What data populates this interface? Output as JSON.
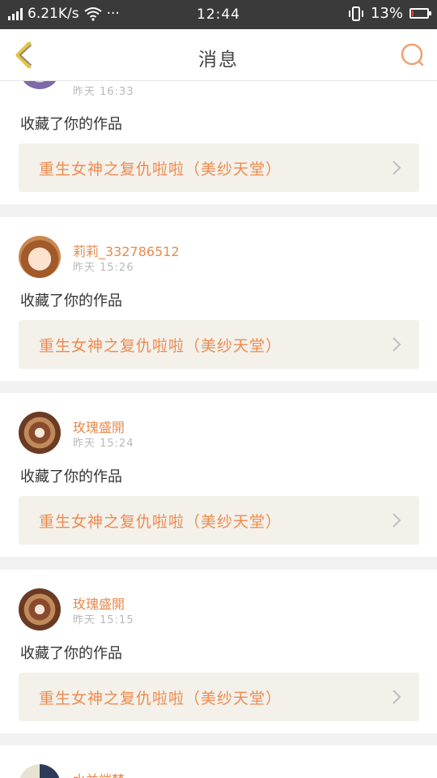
{
  "status_bar": {
    "speed": "6.21K/s",
    "more": "···",
    "time": "12:44",
    "battery": "13%",
    "battery_level": 0.13,
    "battery_color": "#e53935"
  },
  "header": {
    "title": "消息",
    "back_icon": "chevron-left-icon",
    "search_icon": "search-icon",
    "accent_color": "#f0a070"
  },
  "messages": [
    {
      "name": "",
      "time": "昨天 16:33",
      "action": "收藏了你的作品",
      "work": "重生女神之复仇啦啦（美纱天堂）"
    },
    {
      "name": "莉莉_332786512",
      "time": "昨天 15:26",
      "action": "收藏了你的作品",
      "work": "重生女神之复仇啦啦（美纱天堂）"
    },
    {
      "name": "玫瑰盛開",
      "time": "昨天 15:24",
      "action": "收藏了你的作品",
      "work": "重生女神之复仇啦啦（美纱天堂）"
    },
    {
      "name": "玫瑰盛開",
      "time": "昨天 15:15",
      "action": "收藏了你的作品",
      "work": "重生女神之复仇啦啦（美纱天堂）"
    },
    {
      "name": "水並端梦",
      "time": "",
      "action": "",
      "work": ""
    }
  ]
}
